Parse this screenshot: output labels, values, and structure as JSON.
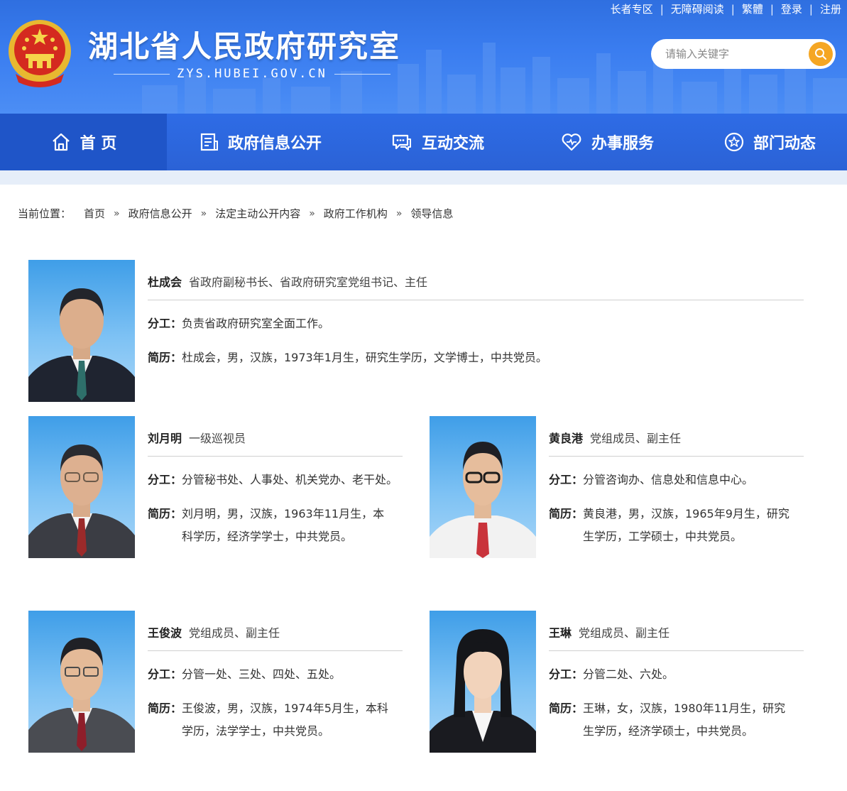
{
  "header": {
    "site_title": "湖北省人民政府研究室",
    "domain": "ZYS.HUBEI.GOV.CN",
    "top_links": [
      "长者专区",
      "无障碍阅读",
      "繁體",
      "登录",
      "注册"
    ],
    "search_placeholder": "请输入关键字"
  },
  "nav": {
    "items": [
      {
        "label": "首 页",
        "icon": "home-icon"
      },
      {
        "label": "政府信息公开",
        "icon": "document-icon"
      },
      {
        "label": "互动交流",
        "icon": "chat-icon"
      },
      {
        "label": "办事服务",
        "icon": "heart-icon"
      },
      {
        "label": "部门动态",
        "icon": "star-icon"
      }
    ]
  },
  "breadcrumb": {
    "label": "当前位置：",
    "items": [
      "首页",
      "政府信息公开",
      "法定主动公开内容",
      "政府工作机构",
      "领导信息"
    ],
    "separator": "»"
  },
  "labels": {
    "duty": "分工：",
    "bio": "简历："
  },
  "leaders": [
    {
      "name": "杜成会",
      "title": "省政府副秘书长、省政府研究室党组书记、主任",
      "duty": "负责省政府研究室全面工作。",
      "bio_lines": [
        "杜成会，男，汉族，1973年1月生，研究生学历，文学博士，中共党员。"
      ]
    },
    {
      "name": "刘月明",
      "title": "一级巡视员",
      "duty": "分管秘书处、人事处、机关党办、老干处。",
      "bio_lines": [
        "刘月明，男，汉族，1963年11月生，本",
        "科学历，经济学学士，中共党员。"
      ]
    },
    {
      "name": "黄良港",
      "title": "党组成员、副主任",
      "duty": "分管咨询办、信息处和信息中心。",
      "bio_lines": [
        "黄良港，男，汉族，1965年9月生，研究",
        "生学历，工学硕士，中共党员。"
      ]
    },
    {
      "name": "王俊波",
      "title": "党组成员、副主任",
      "duty": "分管一处、三处、四处、五处。",
      "bio_lines": [
        "王俊波，男，汉族，1974年5月生，本科",
        "学历，法学学士，中共党员。"
      ]
    },
    {
      "name": "王琳",
      "title": "党组成员、副主任",
      "duty": "分管二处、六处。",
      "bio_lines": [
        "王琳，女，汉族，1980年11月生，研究",
        "生学历，经济学硕士，中共党员。"
      ]
    }
  ],
  "colors": {
    "header_blue": "#3a7df0",
    "nav_blue": "#2b62d6",
    "nav_active": "#1f55c8",
    "search_button": "#f5a623"
  }
}
